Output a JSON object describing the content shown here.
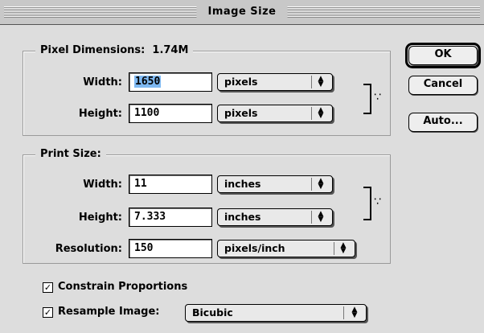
{
  "window": {
    "title": "Image Size"
  },
  "pixel_dimensions": {
    "legend": "Pixel Dimensions:  1.74M",
    "width": {
      "label": "Width:",
      "value": "1650",
      "unit": "pixels"
    },
    "height": {
      "label": "Height:",
      "value": "1100",
      "unit": "pixels"
    }
  },
  "print_size": {
    "legend": "Print Size:",
    "width": {
      "label": "Width:",
      "value": "11",
      "unit": "inches"
    },
    "height": {
      "label": "Height:",
      "value": "7.333",
      "unit": "inches"
    },
    "resolution": {
      "label": "Resolution:",
      "value": "150",
      "unit": "pixels/inch"
    }
  },
  "options": {
    "constrain": {
      "label": "Constrain Proportions",
      "checked": true
    },
    "resample": {
      "label": "Resample Image:",
      "checked": true,
      "method": "Bicubic"
    }
  },
  "buttons": {
    "ok": "OK",
    "cancel": "Cancel",
    "auto": "Auto..."
  },
  "icons": {
    "popup_arrows": "up-down-arrows-icon",
    "link": "chain-link-icon",
    "check": "checkmark-icon"
  },
  "colors": {
    "background": "#dddddd",
    "selection": "#7fb9f2"
  }
}
